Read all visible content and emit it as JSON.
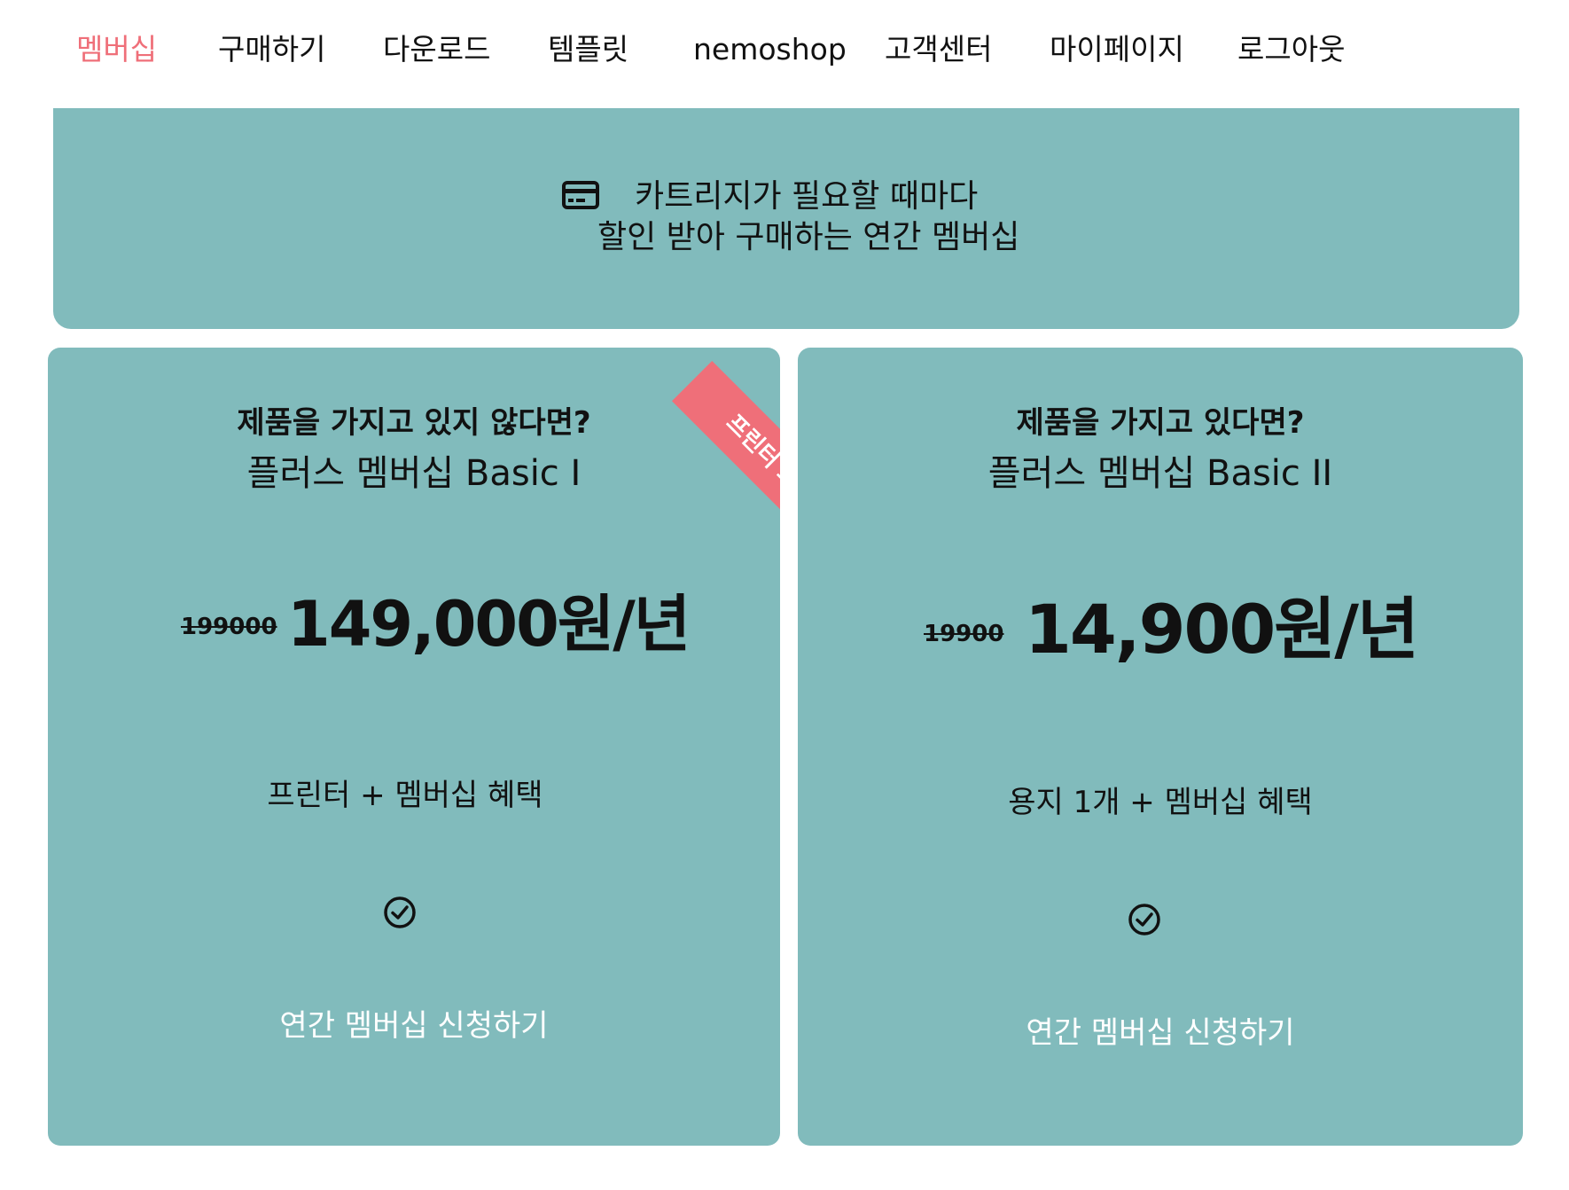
{
  "nav": {
    "items": [
      {
        "label": "멤버십",
        "active": true
      },
      {
        "label": "구매하기",
        "active": false
      },
      {
        "label": "다운로드",
        "active": false
      },
      {
        "label": "템플릿",
        "active": false
      },
      {
        "label": "nemoshop",
        "active": false
      },
      {
        "label": "고객센터",
        "active": false
      },
      {
        "label": "마이페이지",
        "active": false
      },
      {
        "label": "로그아웃",
        "active": false
      }
    ],
    "active_color": "#ef6f79"
  },
  "banner": {
    "icon": "credit-card-icon",
    "line1": "카트리지가 필요할 때마다",
    "line2": "할인 받아 구매하는 연간 멤버십",
    "background": "#81bbbc"
  },
  "plans": [
    {
      "subtitle": "제품을 가지고 있지 않다면?",
      "title": "플러스 멤버십 Basic I",
      "old_price": "199000",
      "price": "149,000원/년",
      "benefit": "프린터 + 멤버십 혜택",
      "check_icon": "check-circle-icon",
      "apply_label": "연간 멤버십 신청하기",
      "ribbon": "프린터 포함",
      "ribbon_color": "#ef6f79"
    },
    {
      "subtitle": "제품을 가지고 있다면?",
      "title": "플러스 멤버십 Basic II",
      "old_price": "19900",
      "price": "14,900원/년",
      "benefit": "용지 1개 + 멤버십 혜택",
      "check_icon": "check-circle-icon",
      "apply_label": "연간 멤버십 신청하기"
    }
  ]
}
